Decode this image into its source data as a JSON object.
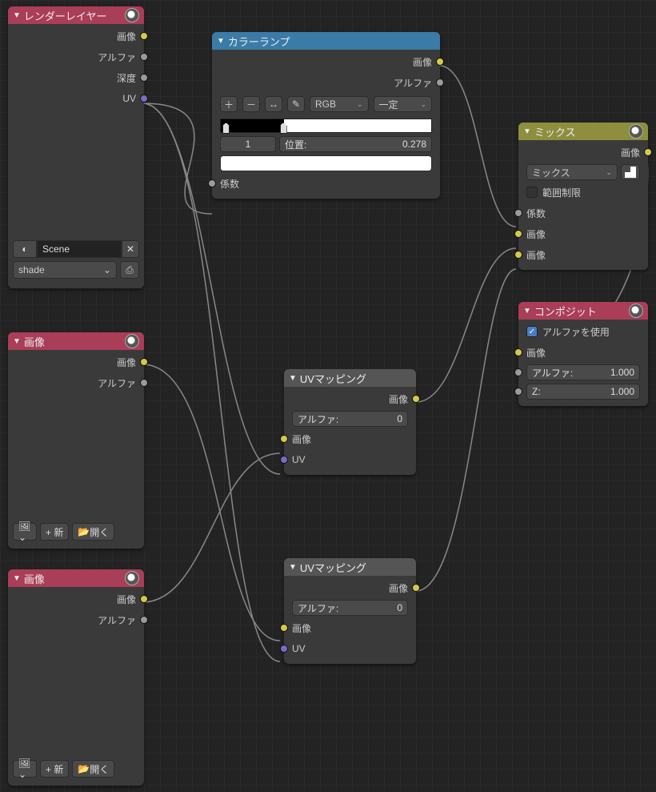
{
  "nodes": {
    "render_layers": {
      "title": "レンダーレイヤー",
      "outputs": {
        "image": "画像",
        "alpha": "アルファ",
        "depth": "深度",
        "uv": "UV"
      },
      "scene_value": "Scene",
      "layer_value": "shade"
    },
    "color_ramp": {
      "title": "カラーランプ",
      "outputs": {
        "image": "画像",
        "alpha": "アルファ"
      },
      "mode": "RGB",
      "interp": "一定",
      "fac_label": "係数",
      "pos_row": {
        "value": "1",
        "label": "位置:",
        "pos": "0.278"
      }
    },
    "image1": {
      "title": "画像",
      "outputs": {
        "image": "画像",
        "alpha": "アルファ"
      },
      "footer": {
        "new": "+  新",
        "open": "開く"
      }
    },
    "image2": {
      "title": "画像",
      "outputs": {
        "image": "画像",
        "alpha": "アルファ"
      },
      "footer": {
        "new": "+  新",
        "open": "開く"
      }
    },
    "uvmap1": {
      "title": "UVマッピング",
      "outputs": {
        "image": "画像"
      },
      "alpha_label": "アルファ:",
      "alpha_value": "0",
      "inputs": {
        "image": "画像",
        "uv": "UV"
      }
    },
    "uvmap2": {
      "title": "UVマッピング",
      "outputs": {
        "image": "画像"
      },
      "alpha_label": "アルファ:",
      "alpha_value": "0",
      "inputs": {
        "image": "画像",
        "uv": "UV"
      }
    },
    "mix": {
      "title": "ミックス",
      "outputs": {
        "image": "画像"
      },
      "blend_mode": "ミックス",
      "clamp_label": "範囲制限",
      "inputs": {
        "fac": "係数",
        "image1": "画像",
        "image2": "画像"
      }
    },
    "composite": {
      "title": "コンポジット",
      "use_alpha": "アルファを使用",
      "inputs": {
        "image": "画像",
        "alpha_label": "アルファ:",
        "alpha_val": "1.000",
        "z_label": "Z:",
        "z_val": "1.000"
      }
    }
  }
}
